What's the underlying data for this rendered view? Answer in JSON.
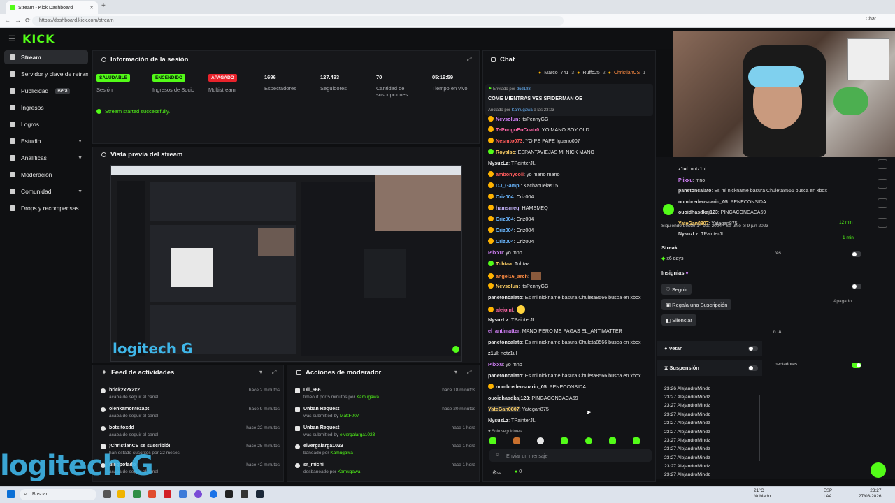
{
  "browser": {
    "tab_title": "Stream - Kick Dashboard",
    "url": "https://dashboard.kick.com/stream",
    "chat_label": "Chat"
  },
  "brand": {
    "logo": "KICK",
    "accent": "#53fc18"
  },
  "sidebar": {
    "items": [
      {
        "label": "Stream",
        "icon": "broadcast-icon"
      },
      {
        "label": "Servidor y clave de retransmisión",
        "icon": "key-icon"
      },
      {
        "label": "Publicidad",
        "badge": "Beta",
        "icon": "megaphone-icon"
      },
      {
        "label": "Ingresos",
        "icon": "money-icon"
      },
      {
        "label": "Logros",
        "icon": "trophy-icon"
      },
      {
        "label": "Estudio",
        "icon": "studio-icon"
      },
      {
        "label": "Analíticas",
        "icon": "chart-icon"
      },
      {
        "label": "Moderación",
        "icon": "shield-icon"
      },
      {
        "label": "Comunidad",
        "icon": "community-icon"
      },
      {
        "label": "Drops y recompensas",
        "icon": "gift-icon"
      }
    ]
  },
  "session": {
    "title": "Información de la sesión",
    "stats": [
      {
        "badge": "SALUDABLE",
        "label": "Sesión"
      },
      {
        "badge": "ENCENDIDO",
        "label": "Ingresos de Socio"
      },
      {
        "badge": "APAGADO",
        "label": "Multistream"
      },
      {
        "value": "1696",
        "label": "Espectadores"
      },
      {
        "value": "127.493",
        "label": "Seguidores"
      },
      {
        "value": "70",
        "label": "Cantidad de suscripciones"
      },
      {
        "value": "05:19:59",
        "label": "Tiempo en vivo"
      }
    ],
    "status": "Stream started successfully."
  },
  "preview": {
    "title": "Vista previa del stream",
    "watermark": "logitech G"
  },
  "feed": {
    "title": "Feed de actividades",
    "items": [
      {
        "name": "brick2x2x2x2",
        "sub": "acaba de seguir el canal",
        "time": "hace 2 minutos"
      },
      {
        "name": "olenkamontezapt",
        "sub": "acaba de seguir el canal",
        "time": "hace 9 minutos"
      },
      {
        "name": "botsitoxdd",
        "sub": "acaba de seguir el canal",
        "time": "hace 22 minutos"
      },
      {
        "name": "¡ChristianCS se suscribió!",
        "sub": "han estado suscritos por 22 meses",
        "time": "hace 25 minutos"
      },
      {
        "name": "dingpotado",
        "sub": "acaba de seguir el canal",
        "time": "hace 42 minutos"
      }
    ]
  },
  "modactions": {
    "title": "Acciones de moderador",
    "items": [
      {
        "name": "Dil_666",
        "sub": "timeout por 5 minutos por",
        "by": "Kamugawa",
        "time": "hace 18 minutos"
      },
      {
        "name": "Unban Request",
        "sub": "was submitted by",
        "by": "MattF007",
        "time": "hace 20 minutos"
      },
      {
        "name": "Unban Request",
        "sub": "was submitted by",
        "by": "elvergalarga1023",
        "time": "hace 1 hora"
      },
      {
        "name": "elvergalarga1023",
        "sub": "baneado por",
        "by": "Kamugawa",
        "time": "hace 1 hora"
      },
      {
        "name": "sr_michi",
        "sub": "desbaneado por",
        "by": "Kamugawa",
        "time": "hace 1 hora"
      }
    ]
  },
  "chat": {
    "title": "Chat",
    "top_gifters": [
      "Marco_741",
      "3",
      "Ruffo25",
      "2",
      "ChristianCS",
      "1"
    ],
    "pinned": {
      "sent_by_label": "Enviado por",
      "sent_by": "dud188",
      "message": "COME MIENTRAS VES SPIDERMAN OE",
      "pinned_by_label": "Anclado por",
      "pinned_by": "Kamugawa",
      "pinned_at": "a las 23:03"
    },
    "messages": [
      {
        "user": "Nevsolun",
        "text": ": ItsPennyGG",
        "color": "#d884ff"
      },
      {
        "user": "TePongoEnCuatr0",
        "text": ": YO MANO SOY OLD",
        "color": "#ff66a6"
      },
      {
        "user": "Nesmto073",
        "text": ": YO PE PAPE Iguano007",
        "color": "#ff5c5c"
      },
      {
        "user": "Royalsc",
        "text": ": ESPANTAVIEJAS MI NICK MANO",
        "color": "#ffd166"
      },
      {
        "user": "NysuzLz",
        "text": ": TPainterJL",
        "color": "#e6e6e6"
      },
      {
        "user": "ambonycoll",
        "text": ": yo mano mano",
        "color": "#ff5c5c"
      },
      {
        "user": "DJ_Gampi",
        "text": ": Kachabuelas15",
        "color": "#6ab7ff"
      },
      {
        "user": "Criz004",
        "text": ": Criz004",
        "color": "#6ab7ff"
      },
      {
        "user": "hamsmeq",
        "text": ": HAMSMEQ",
        "color": "#c8b6ff"
      },
      {
        "user": "Criz004",
        "text": ": Criz004",
        "color": "#6ab7ff"
      },
      {
        "user": "Criz004",
        "text": ": Criz004",
        "color": "#6ab7ff"
      },
      {
        "user": "Criz004",
        "text": ": Criz004",
        "color": "#6ab7ff"
      },
      {
        "user": "Piixxu",
        "text": ": yo mno",
        "color": "#d884ff"
      },
      {
        "user": "Tohtaa",
        "text": ": Tohtaa",
        "color": "#ffd166"
      },
      {
        "user": "angel16_arch",
        "text": ":",
        "color": "#ff8c42"
      },
      {
        "user": "Nevsolun",
        "text": ": ItsPennyGG",
        "color": "#ffd166"
      },
      {
        "user": "panetoncalato",
        "text": ": Es mi nickname basura Chuleta8566 busca en xbox",
        "color": "#e6e6e6"
      },
      {
        "user": "alejoml",
        "text": ":",
        "color": "#ff66a6"
      },
      {
        "user": "NysuzLz",
        "text": ": TPainterJL",
        "color": "#e6e6e6"
      },
      {
        "user": "el_antimatter",
        "text": ": MANO PERO ME PAGAS EL_ANTIMATTER",
        "color": "#d884ff"
      },
      {
        "user": "panetoncalato",
        "text": ": Es mi nickname basura Chuleta8566 busca en xbox",
        "color": "#e6e6e6"
      },
      {
        "user": "z1ul",
        "text": ": notz1ul",
        "color": "#e6e6e6"
      },
      {
        "user": "Piixxu",
        "text": ": yo mno",
        "color": "#d884ff"
      },
      {
        "user": "panetoncalato",
        "text": ": Es mi nickname basura Chuleta8566 busca en xbox",
        "color": "#e6e6e6"
      },
      {
        "user": "nombredeusuario_05",
        "text": ": PENECONSIDA",
        "color": "#e6e6e6"
      },
      {
        "user": "ouoidhasdkaj123",
        "text": ": PINGACONCACA69",
        "color": "#e6e6e6"
      },
      {
        "user": "YateGan0807",
        "text": ": Yategan875",
        "color": "#ffd166"
      },
      {
        "user": "NysuzLz",
        "text": ": TPainterJL",
        "color": "#e6e6e6"
      }
    ],
    "followers_only": "Solo seguidores",
    "input_placeholder": "Enviar un mensaje",
    "points": "0"
  },
  "usercard": {
    "overlay_lines": [
      {
        "user": "z1ul",
        "text": ": notz1ul"
      },
      {
        "user": "Piixxu",
        "text": ": mno"
      },
      {
        "user": "panetoncalato",
        "text": ": Es mi nickname basura Chuleta8566 busca en xbox"
      },
      {
        "user": "nombredeusuario_05",
        "text": ": PENECONSIDA"
      },
      {
        "user": "ouoidhasdkaj123",
        "text": ": PINGACONCACA69"
      },
      {
        "user": "YateGan0807",
        "text": ": Yategan875"
      },
      {
        "user": "NysuzLz",
        "text": ": TPainterJL"
      }
    ],
    "following_since_label": "Siguiendo desde",
    "following_since": "14 oct. 2024",
    "joined_label": "Se unió el",
    "joined": "9 jun 2023",
    "streak_label": "Streak",
    "streak_value": "x6 days",
    "badges_label": "Insignias",
    "follow_btn": "Seguir",
    "gift_btn": "Regala una Suscripción",
    "mute_btn": "Silenciar",
    "veto_label": "Vetar",
    "suspend_label": "Suspensión",
    "log_entries": [
      {
        "time": "23:26",
        "user": "AlejandroMindz"
      },
      {
        "time": "23:27",
        "user": "AlejandroMindz"
      },
      {
        "time": "23:27",
        "user": "AlejandroMindz"
      },
      {
        "time": "23:27",
        "user": "AlejandroMindz"
      },
      {
        "time": "23:27",
        "user": "AlejandroMindz"
      },
      {
        "time": "23:27",
        "user": "AlejandroMindz"
      },
      {
        "time": "23:27",
        "user": "AlejandroMindz"
      },
      {
        "time": "23:27",
        "user": "AlejandroMindz"
      },
      {
        "time": "23:27",
        "user": "AlejandroMindz"
      },
      {
        "time": "23:27",
        "user": "AlejandroMindz"
      },
      {
        "time": "23:27",
        "user": "AlejandroMindz"
      }
    ]
  },
  "rightpane": {
    "times": [
      "12 min",
      "1 min"
    ],
    "apagado": "Apagado",
    "ia": "n IA",
    "espectadores": "pectadores",
    "res": "res"
  },
  "taskbar": {
    "search": "Buscar",
    "weather": "21°C",
    "weather_desc": "Nublado",
    "lang": "ESP",
    "lang2": "LAA",
    "time": "23:27",
    "date": "27/08/2026"
  },
  "overlay": {
    "logitech": "logitech G"
  }
}
